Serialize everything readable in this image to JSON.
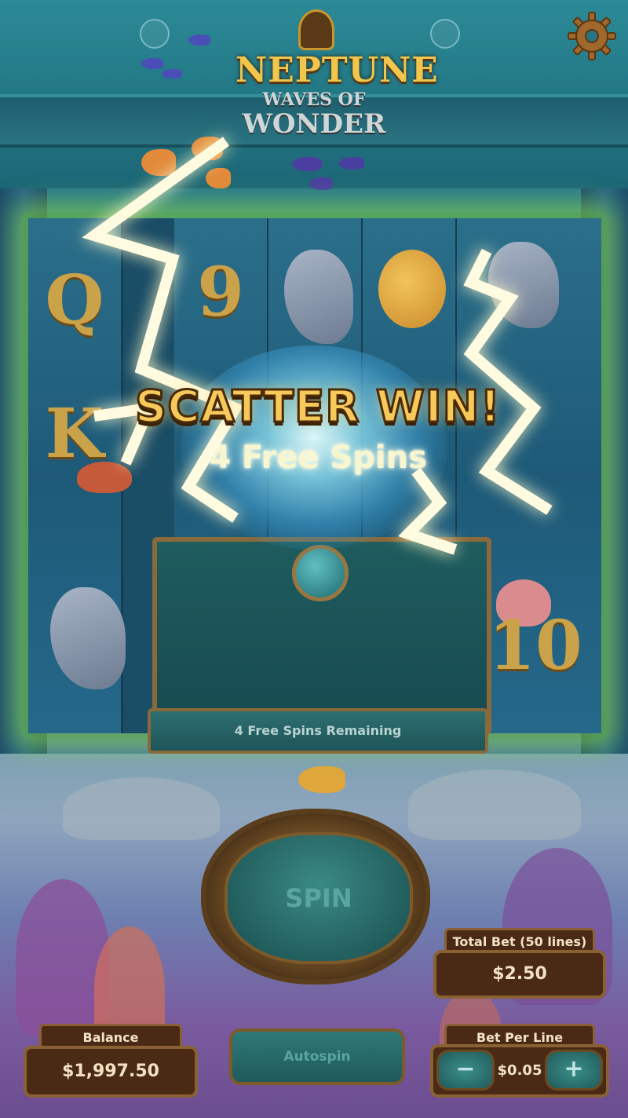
{
  "logo": {
    "line1": "NEPTUNE",
    "line2": "WAVES OF",
    "line3": "WONDER"
  },
  "icons": {
    "settings": "gear-icon"
  },
  "scatter": {
    "title": "SCATTER WIN!",
    "subtitle": "4 Free Spins"
  },
  "reels": {
    "visible_symbols": [
      "Q",
      "9",
      "K",
      "10"
    ]
  },
  "free_spins": {
    "status": "4 Free Spins Remaining"
  },
  "spin": {
    "label": "SPIN"
  },
  "autospin": {
    "label": "Autospin"
  },
  "total_bet": {
    "label": "Total Bet (50 lines)",
    "value": "$2.50"
  },
  "balance": {
    "label": "Balance",
    "value": "$1,997.50"
  },
  "bet_per_line": {
    "label": "Bet Per Line",
    "value": "$0.05",
    "minus": "−",
    "plus": "+"
  },
  "colors": {
    "accent_gold": "#f6c95a",
    "panel_brown": "#4a2a14",
    "reel_glow": "#8cdc46"
  }
}
